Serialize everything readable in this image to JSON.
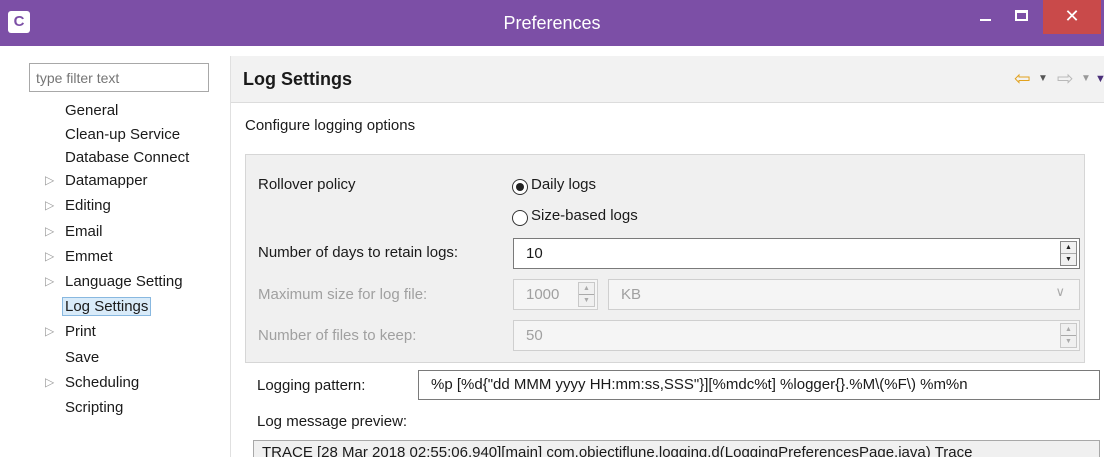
{
  "window": {
    "title": "Preferences",
    "app_icon_letter": "C",
    "minimize": "–",
    "maximize": "□",
    "close": "✕"
  },
  "sidebar": {
    "filter_placeholder": "type filter text",
    "items": [
      {
        "label": "General",
        "expandable": false
      },
      {
        "label": "Clean-up Service",
        "expandable": false
      },
      {
        "label": "Database Connect",
        "expandable": false
      },
      {
        "label": "Datamapper",
        "expandable": true
      },
      {
        "label": "Editing",
        "expandable": true
      },
      {
        "label": "Email",
        "expandable": true
      },
      {
        "label": "Emmet",
        "expandable": true
      },
      {
        "label": "Language Setting",
        "expandable": true
      },
      {
        "label": "Log Settings",
        "expandable": false,
        "selected": true
      },
      {
        "label": "Print",
        "expandable": true
      },
      {
        "label": "Save",
        "expandable": false
      },
      {
        "label": "Scheduling",
        "expandable": true
      },
      {
        "label": "Scripting",
        "expandable": false
      }
    ]
  },
  "header": {
    "title": "Log Settings",
    "back_icon": "⇦",
    "forward_icon": "⇨",
    "dropdown_icon": "▼"
  },
  "main": {
    "description": "Configure logging options",
    "rollover_label": "Rollover policy",
    "rollover_options": [
      "Daily logs",
      "Size-based logs"
    ],
    "rollover_selected": "Daily logs",
    "days_label": "Number of days to retain logs:",
    "days_value": "10",
    "max_size_label": "Maximum size for log file:",
    "max_size_value": "1000",
    "max_size_unit": "KB",
    "files_label": "Number of files to keep:",
    "files_value": "50",
    "pattern_label": "Logging pattern:",
    "pattern_value": "%p [%d{\"dd MMM yyyy HH:mm:ss,SSS\"}][%mdc%t] %logger{}.%M\\(%F\\) %m%n",
    "preview_label": "Log message preview:",
    "preview_value": "TRACE [28 Mar 2018 02:55:06,940][main] com.objectiflune.logging.d(LoggingPreferencesPage.java) Trace"
  }
}
